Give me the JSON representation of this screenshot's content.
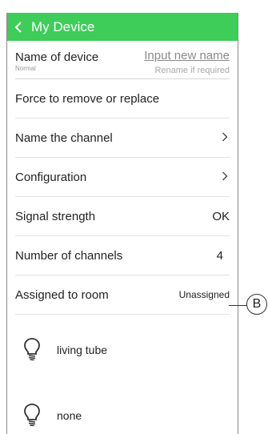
{
  "header": {
    "title": "My Device",
    "back_icon": "chevron-left-icon"
  },
  "name_device": {
    "label": "Name of device",
    "sublabel": "Normal",
    "input_link": "Input new name",
    "hint": "Rename if required"
  },
  "rows": {
    "force_remove": "Force to remove or replace",
    "name_channel": "Name the channel",
    "configuration": "Configuration",
    "signal_label": "Signal strength",
    "signal_value": "OK",
    "channels_label": "Number of channels",
    "channels_value": "4",
    "room_label": "Assigned to room",
    "room_value": "Unassigned"
  },
  "devices": [
    {
      "name": "living tube",
      "icon": "lightbulb-icon"
    },
    {
      "name": "none",
      "icon": "lightbulb-icon"
    }
  ],
  "callout": {
    "label": "B"
  },
  "colors": {
    "header_bg": "#3dcd58",
    "header_text": "#ffffff"
  }
}
